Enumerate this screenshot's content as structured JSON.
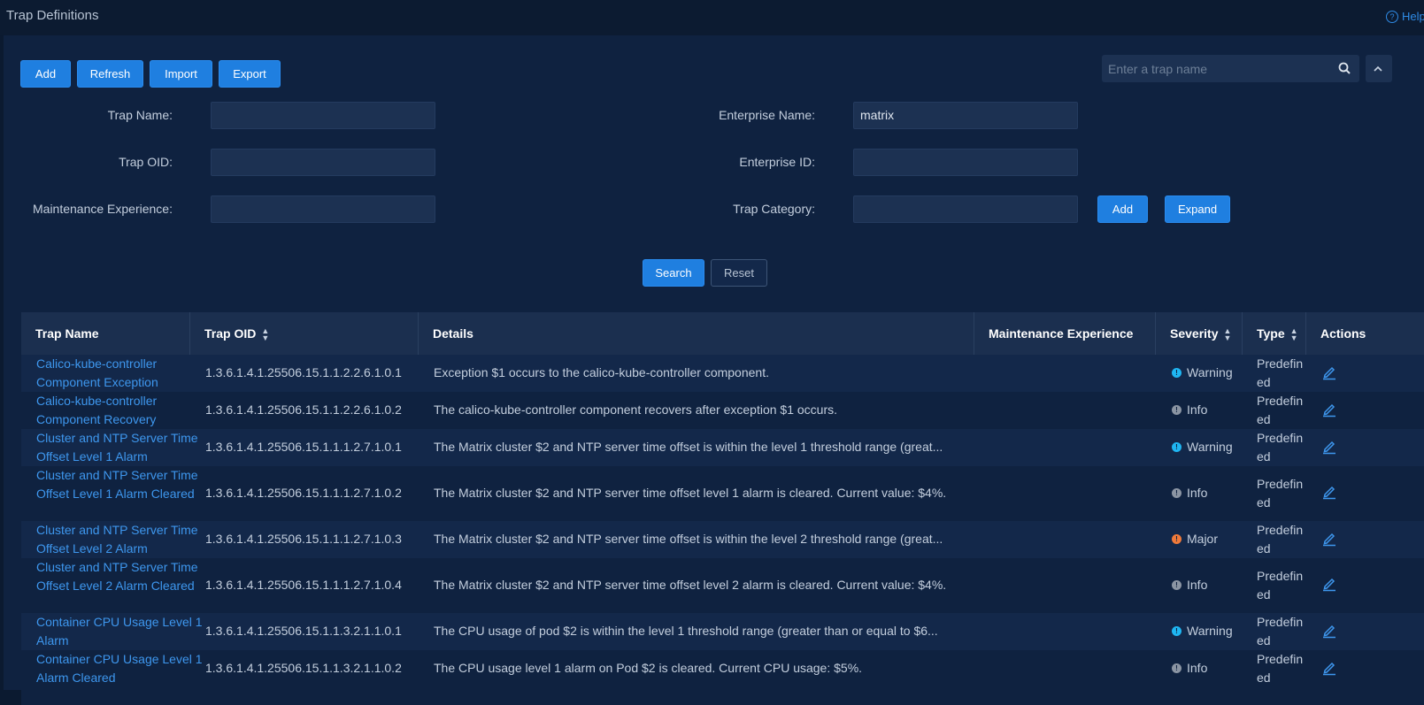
{
  "header": {
    "title": "Trap Definitions",
    "help_label": "Help"
  },
  "toolbar": {
    "add": "Add",
    "refresh": "Refresh",
    "import": "Import",
    "export": "Export"
  },
  "quick_search": {
    "placeholder": "Enter a trap name"
  },
  "filters": {
    "trap_name_label": "Trap Name:",
    "trap_name_value": "",
    "trap_oid_label": "Trap OID:",
    "trap_oid_value": "",
    "maint_label": "Maintenance Experience:",
    "maint_value": "",
    "enterprise_name_label": "Enterprise Name:",
    "enterprise_name_value": "matrix",
    "enterprise_id_label": "Enterprise ID:",
    "enterprise_id_value": "",
    "category_label": "Trap Category:",
    "category_value": "",
    "add_label": "Add",
    "expand_label": "Expand",
    "search_label": "Search",
    "reset_label": "Reset"
  },
  "table": {
    "columns": [
      "Trap Name",
      "Trap OID",
      "Details",
      "Maintenance Experience",
      "Severity",
      "Type",
      "Actions"
    ],
    "rows": [
      {
        "name": "Calico-kube-controller Component Exception",
        "oid": "1.3.6.1.4.1.25506.15.1.1.2.2.6.1.0.1",
        "details": "Exception $1 occurs to the calico-kube-controller component.",
        "maint": "",
        "severity": "Warning",
        "type": "Predefined"
      },
      {
        "name": "Calico-kube-controller Component Recovery",
        "oid": "1.3.6.1.4.1.25506.15.1.1.2.2.6.1.0.2",
        "details": "The calico-kube-controller component recovers after exception $1 occurs.",
        "maint": "",
        "severity": "Info",
        "type": "Predefined"
      },
      {
        "name": "Cluster and NTP Server Time Offset Level 1 Alarm",
        "oid": "1.3.6.1.4.1.25506.15.1.1.1.2.7.1.0.1",
        "details": "The Matrix cluster $2 and NTP server time offset is within the level 1 threshold range (great...",
        "maint": "",
        "severity": "Warning",
        "type": "Predefined"
      },
      {
        "name": "Cluster and NTP Server Time Offset Level 1 Alarm Cleared",
        "oid": "1.3.6.1.4.1.25506.15.1.1.1.2.7.1.0.2",
        "details": "The Matrix cluster $2 and NTP server time offset level 1 alarm is cleared. Current value: $4%.",
        "maint": "",
        "severity": "Info",
        "type": "Predefined"
      },
      {
        "name": "Cluster and NTP Server Time Offset Level 2 Alarm",
        "oid": "1.3.6.1.4.1.25506.15.1.1.1.2.7.1.0.3",
        "details": "The Matrix cluster $2 and NTP server time offset is within the level 2 threshold range (great...",
        "maint": "",
        "severity": "Major",
        "type": "Predefined"
      },
      {
        "name": "Cluster and NTP Server Time Offset Level 2 Alarm Cleared",
        "oid": "1.3.6.1.4.1.25506.15.1.1.1.2.7.1.0.4",
        "details": "The Matrix cluster $2 and NTP server time offset level 2 alarm is cleared. Current value: $4%.",
        "maint": "",
        "severity": "Info",
        "type": "Predefined"
      },
      {
        "name": "Container CPU Usage Level 1 Alarm",
        "oid": "1.3.6.1.4.1.25506.15.1.1.3.2.1.1.0.1",
        "details": "The CPU usage of pod $2 is within the level 1 threshold range (greater than or equal to $6...",
        "maint": "",
        "severity": "Warning",
        "type": "Predefined"
      },
      {
        "name": "Container CPU Usage Level 1 Alarm Cleared",
        "oid": "1.3.6.1.4.1.25506.15.1.1.3.2.1.1.0.2",
        "details": "The CPU usage level 1 alarm on Pod $2 is cleared. Current CPU usage: $5%.",
        "maint": "",
        "severity": "Info",
        "type": "Predefined"
      }
    ]
  },
  "colors": {
    "warning": "#1fb6f2",
    "info": "#8b95a3",
    "major": "#f07a3a",
    "accent": "#1f7fe0",
    "link": "#3e97ee"
  },
  "icons": {
    "search": "search-icon",
    "help": "help-icon",
    "edit": "edit-icon",
    "collapse": "chevron-up-icon",
    "sort": "sort-icon"
  }
}
